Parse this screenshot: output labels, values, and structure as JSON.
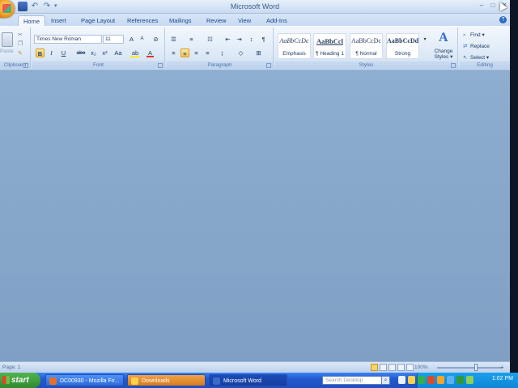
{
  "window": {
    "title": "Microsoft Word",
    "controls": {
      "minimize": "–",
      "maximize": "□",
      "close": "✕"
    }
  },
  "quick_access": {
    "undo": "↶",
    "redo": "↷",
    "more": "▾"
  },
  "tabs": [
    {
      "label": "Home",
      "active": true
    },
    {
      "label": "Insert"
    },
    {
      "label": "Page Layout"
    },
    {
      "label": "References"
    },
    {
      "label": "Mailings"
    },
    {
      "label": "Review"
    },
    {
      "label": "View"
    },
    {
      "label": "Add-Ins"
    }
  ],
  "help": "?",
  "ribbon": {
    "clipboard": {
      "group_label": "Clipboard",
      "paste_label": "Paste"
    },
    "font": {
      "group_label": "Font",
      "font_name": "Times New Roman",
      "font_size": "11",
      "grow": "A",
      "shrink": "A",
      "clear": "⊘",
      "bold": "B",
      "italic": "I",
      "underline": "U",
      "strikethrough": "abe",
      "subscript": "x₂",
      "superscript": "x²",
      "change_case": "Aa",
      "highlight": "ab",
      "font_color": "A"
    },
    "paragraph": {
      "group_label": "Paragraph",
      "show_marks": "¶",
      "sort": "↕"
    },
    "styles": {
      "group_label": "Styles",
      "items": [
        {
          "sample": "AaBbCcDc",
          "name": "Emphasis"
        },
        {
          "sample": "AaBbCcl",
          "name": "¶ Heading 1"
        },
        {
          "sample": "AaBbCcDc",
          "name": "¶ Normal"
        },
        {
          "sample": "AaBbCcDd",
          "name": "Strong"
        }
      ],
      "change_styles_icon": "A",
      "change_styles_label": "Change Styles ▾"
    },
    "editing": {
      "group_label": "Editing",
      "find": "Find ▾",
      "replace": "Replace",
      "select": "Select ▾"
    }
  },
  "status_bar": {
    "page": "Page: 1",
    "zoom": "100%",
    "zoom_level": 0.5
  },
  "taskbar": {
    "start_label": "start",
    "tasks": [
      {
        "label": "DC00930 - Mozilla Fir...",
        "icon_color": "#e5702a"
      },
      {
        "label": "Downloads",
        "icon_color": "#f7d24a"
      },
      {
        "label": "Microsoft Word",
        "icon_color": "#3a6cc9",
        "active": true
      }
    ],
    "search_placeholder": "Search Desktop",
    "clock": "1:02 PM"
  },
  "colors": {
    "start_green": "#3a9c38",
    "taskbar_blue": "#2359cf",
    "document_bg": "#86a6ca",
    "ribbon_bg": "#dce8f6"
  }
}
